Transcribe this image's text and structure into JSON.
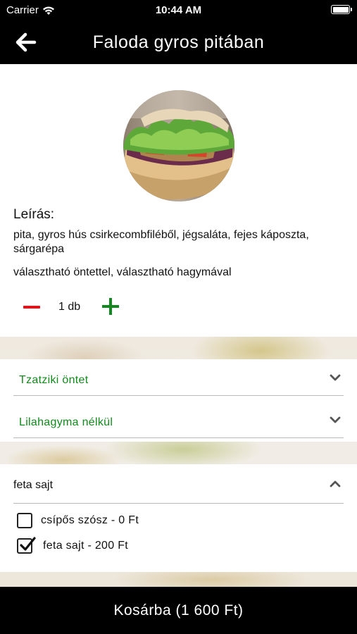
{
  "status_bar": {
    "carrier": "Carrier",
    "time": "10:44 AM"
  },
  "nav": {
    "title": "Faloda gyros pitában",
    "back_icon": "arrow-left-icon"
  },
  "product": {
    "description_heading": "Leírás:",
    "description": "pita, gyros hús csirkecombfiléből, jégsaláta, fejes káposzta, sárgarépa",
    "options_note": "választható öntettel, választható hagymával",
    "quantity_label": "1 db",
    "quantity": 1
  },
  "dropdowns": [
    {
      "label": "Tzatziki öntet",
      "icon": "chevron-down-icon"
    },
    {
      "label": "Lilahagyma nélkül",
      "icon": "chevron-down-icon"
    }
  ],
  "extras": {
    "title": "feta sajt",
    "icon": "chevron-up-icon",
    "options": [
      {
        "label": "csípős szósz - 0 Ft",
        "checked": false
      },
      {
        "label": "feta sajt - 200 Ft",
        "checked": true
      }
    ]
  },
  "cart_button": {
    "label": "Kosárba (1 600 Ft)"
  },
  "colors": {
    "accent_green": "#138a1d",
    "minus_red": "#e0141b",
    "bar_black": "#000000"
  }
}
